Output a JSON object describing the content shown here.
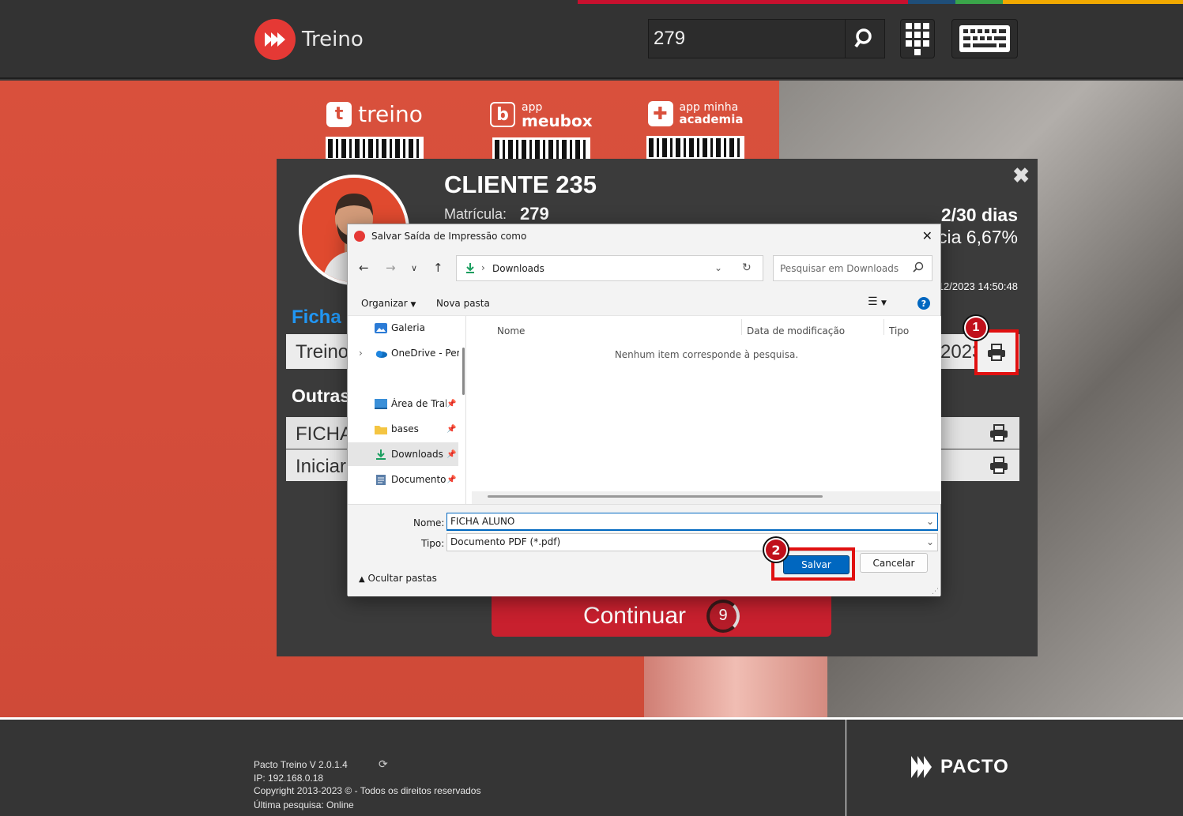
{
  "header": {
    "app_name": "Treino",
    "search_value": "279",
    "stripe_colors": [
      "#c8102e",
      "#1f4e79",
      "#3aa54a",
      "#f2a900"
    ]
  },
  "apps": [
    {
      "name": "treino"
    },
    {
      "name": "meubox"
    },
    {
      "name": "academia"
    }
  ],
  "client": {
    "name": "CLIENTE 235",
    "matricula_label": "Matrícula:",
    "matricula_value": "279",
    "days": "2/30 dias",
    "frequency_fragment": "cia 6,67%",
    "datetime_fragment": "12/2023 14:50:48",
    "ficha_label": "Ficha",
    "treino_label": "Treino",
    "treino_year_fragment": "2023",
    "outras_label": "Outras",
    "other_items": [
      "FICHA",
      "Iniciar"
    ],
    "continue_label": "Continuar",
    "countdown": "9"
  },
  "markers": {
    "first": "1",
    "second": "2"
  },
  "dialog": {
    "title": "Salvar Saída de Impressão como",
    "address": "Downloads",
    "search_placeholder": "Pesquisar em Downloads",
    "organize": "Organizar",
    "new_folder": "Nova pasta",
    "help": "?",
    "sidebar": [
      {
        "label": "Galeria",
        "icon": "gallery-icon"
      },
      {
        "label": "OneDrive - Pers",
        "icon": "onedrive-icon"
      },
      {
        "label": "Área de Traba",
        "icon": "desktop-icon"
      },
      {
        "label": "bases",
        "icon": "folder-icon"
      },
      {
        "label": "Downloads",
        "icon": "download-icon"
      },
      {
        "label": "Documentos",
        "icon": "documents-icon"
      }
    ],
    "columns": [
      "Nome",
      "Data de modificação",
      "Tipo"
    ],
    "empty_message": "Nenhum item corresponde à pesquisa.",
    "name_label": "Nome:",
    "name_value": "FICHA ALUNO",
    "type_label": "Tipo:",
    "type_value": "Documento PDF (*.pdf)",
    "hide_folders": "Ocultar pastas",
    "save": "Salvar",
    "cancel": "Cancelar"
  },
  "footer": {
    "version": "Pacto Treino V 2.0.1.4",
    "ip": "IP: 192.168.0.18",
    "copyright": "Copyright 2013-2023 © - Todos os direitos reservados",
    "last_search": "Última pesquisa: Online",
    "brand": "PACTO"
  }
}
